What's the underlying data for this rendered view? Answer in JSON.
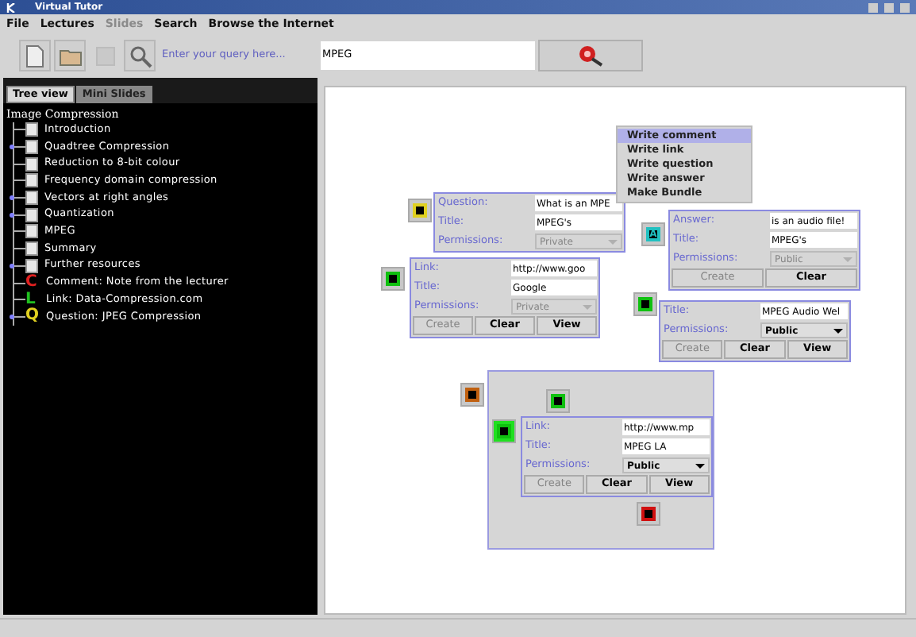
{
  "window": {
    "title": "Virtual Tutor"
  },
  "menu": [
    {
      "label": "File",
      "disabled": false
    },
    {
      "label": "Lectures",
      "disabled": false
    },
    {
      "label": "Slides",
      "disabled": true
    },
    {
      "label": "Search",
      "disabled": false
    },
    {
      "label": "Browse the Internet",
      "disabled": false
    }
  ],
  "toolbar": {
    "buttons": [
      {
        "kind": "new",
        "disabled": false
      },
      {
        "kind": "open",
        "disabled": false
      },
      {
        "kind": "save",
        "disabled": true
      },
      {
        "kind": "find",
        "disabled": false
      }
    ],
    "query_label": "Enter your query here...",
    "query_value": "MPEG"
  },
  "tabs": [
    {
      "label": "Tree view",
      "selected": true
    },
    {
      "label": "Mini Slides",
      "selected": false
    }
  ],
  "tree": {
    "label": "Image Compression",
    "children": [
      {
        "label": "Introduction",
        "kind": "page",
        "expandable": false
      },
      {
        "label": "Quadtree Compression",
        "kind": "page",
        "expandable": true
      },
      {
        "label": "Reduction to 8-bit colour",
        "kind": "page",
        "expandable": false
      },
      {
        "label": "Frequency domain compression",
        "kind": "page",
        "expandable": false
      },
      {
        "label": "Vectors at right angles",
        "kind": "page",
        "expandable": true
      },
      {
        "label": "Quantization",
        "kind": "page",
        "expandable": true
      },
      {
        "label": "MPEG",
        "kind": "page",
        "expandable": false
      },
      {
        "label": "Summary",
        "kind": "page",
        "expandable": false
      },
      {
        "label": "Further resources",
        "kind": "page",
        "expandable": true
      },
      {
        "label": "Comment: Note from the lecturer",
        "kind": "comment",
        "badge": "C",
        "expandable": false
      },
      {
        "label": "Link: Data-Compression.com",
        "kind": "link",
        "badge": "L",
        "expandable": false
      },
      {
        "label": "Question: JPEG Compression",
        "kind": "question",
        "badge": "Q",
        "expandable": true
      }
    ]
  },
  "canvas": {
    "items": [
      {
        "kind": "question_card",
        "fields": [
          {
            "label": "Question:",
            "value": "What is an MPE"
          },
          {
            "label": "Title:",
            "value": "MPEG's"
          }
        ],
        "permissions": {
          "label": "Permissions:",
          "value": "Private",
          "disabled": true
        }
      },
      {
        "kind": "link_card",
        "fields": [
          {
            "label": "Link:",
            "value": "http://www.goo"
          },
          {
            "label": "Title:",
            "value": "Google"
          }
        ],
        "permissions": {
          "label": "Permissions:",
          "value": "Private",
          "disabled": true
        },
        "buttons": [
          {
            "label": "Create",
            "disabled": true
          },
          {
            "label": "Clear",
            "disabled": false
          },
          {
            "label": "View",
            "disabled": false
          }
        ]
      },
      {
        "kind": "answer_card",
        "badge": "A",
        "fields": [
          {
            "label": "Answer:",
            "value": "is an audio file!"
          },
          {
            "label": "Title:",
            "value": "MPEG's"
          }
        ],
        "permissions": {
          "label": "Permissions:",
          "value": "Public",
          "disabled": true
        },
        "buttons": [
          {
            "label": "Create",
            "disabled": true
          },
          {
            "label": "Clear",
            "disabled": false
          }
        ]
      },
      {
        "kind": "link_card",
        "fields": [
          {
            "label": "Title:",
            "value": "MPEG Audio Wel"
          }
        ],
        "permissions": {
          "label": "Permissions:",
          "value": "Public",
          "disabled": false
        },
        "buttons": [
          {
            "label": "Create",
            "disabled": true
          },
          {
            "label": "Clear",
            "disabled": false
          },
          {
            "label": "View",
            "disabled": false
          }
        ]
      },
      {
        "kind": "menu",
        "entries": [
          {
            "label": "Write comment",
            "selected": true
          },
          {
            "label": "Write link",
            "selected": false
          },
          {
            "label": "Write question",
            "selected": false
          },
          {
            "label": "Write answer",
            "selected": false
          },
          {
            "label": "Make Bundle",
            "selected": false
          }
        ]
      },
      {
        "kind": "bundle",
        "children": [
          {
            "kind": "link_icon"
          },
          {
            "kind": "link_card",
            "highlighted": true,
            "fields": [
              {
                "label": "Link:",
                "value": "http://www.mp"
              },
              {
                "label": "Title:",
                "value": "MPEG LA"
              }
            ],
            "permissions": {
              "label": "Permissions:",
              "value": "Public",
              "disabled": false
            },
            "buttons": [
              {
                "label": "Create",
                "disabled": true
              },
              {
                "label": "Clear",
                "disabled": false
              },
              {
                "label": "View",
                "disabled": false
              }
            ]
          },
          {
            "kind": "comment_icon"
          }
        ]
      }
    ]
  }
}
